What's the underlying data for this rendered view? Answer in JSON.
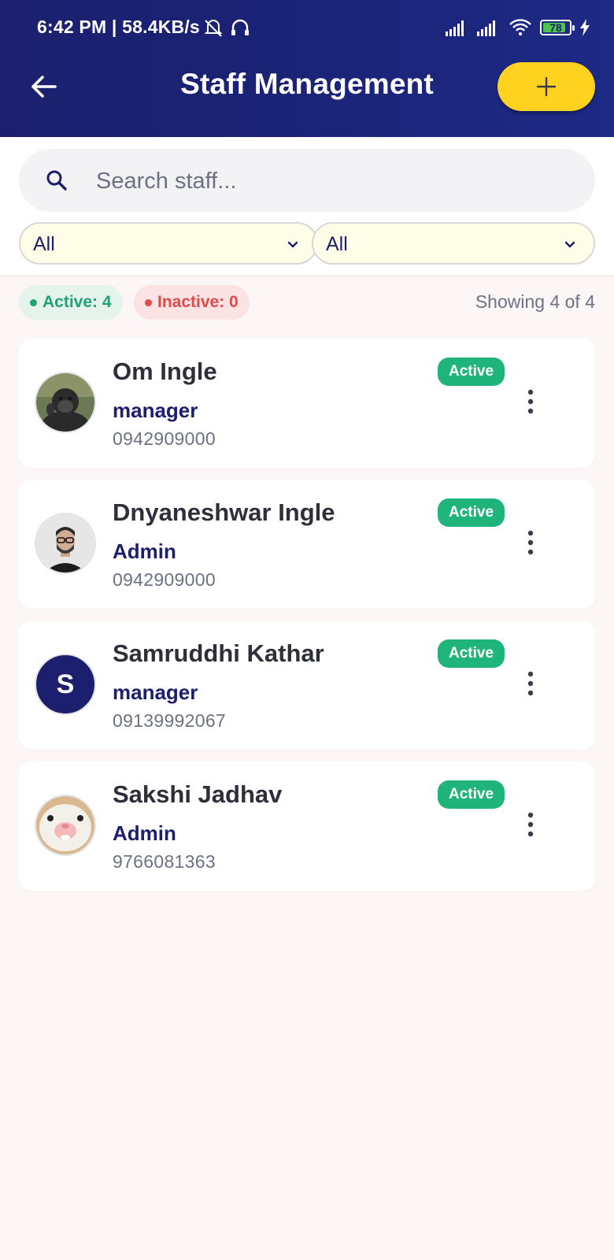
{
  "status_bar": {
    "time": "6:42 PM | 58.4KB/s",
    "battery": "78"
  },
  "header": {
    "title": "Staff Management",
    "add_label": "+"
  },
  "search": {
    "placeholder": "Search staff..."
  },
  "filters": [
    {
      "value": "All"
    },
    {
      "value": "All"
    }
  ],
  "stats": {
    "active_label": "Active: 4",
    "inactive_label": "Inactive: 0",
    "showing": "Showing 4 of 4"
  },
  "staff": [
    {
      "name": "Om Ingle",
      "role": "manager",
      "phone": "0942909000",
      "status": "Active",
      "avatar": "gorilla-photo"
    },
    {
      "name": "Dnyaneshwar Ingle",
      "role": "Admin",
      "phone": "0942909000",
      "status": "Active",
      "avatar": "man-portrait-photo"
    },
    {
      "name": "Samruddhi Kathar",
      "role": "manager",
      "phone": "09139992067",
      "status": "Active",
      "avatar_initial": "S"
    },
    {
      "name": "Sakshi Jadhav",
      "role": "Admin",
      "phone": "9766081363",
      "status": "Active",
      "avatar": "cat-photo"
    }
  ],
  "colors": {
    "primary": "#1b1f6e",
    "accent": "#ffd21f",
    "active": "#1fb47a",
    "inactive": "#e04a4a"
  }
}
